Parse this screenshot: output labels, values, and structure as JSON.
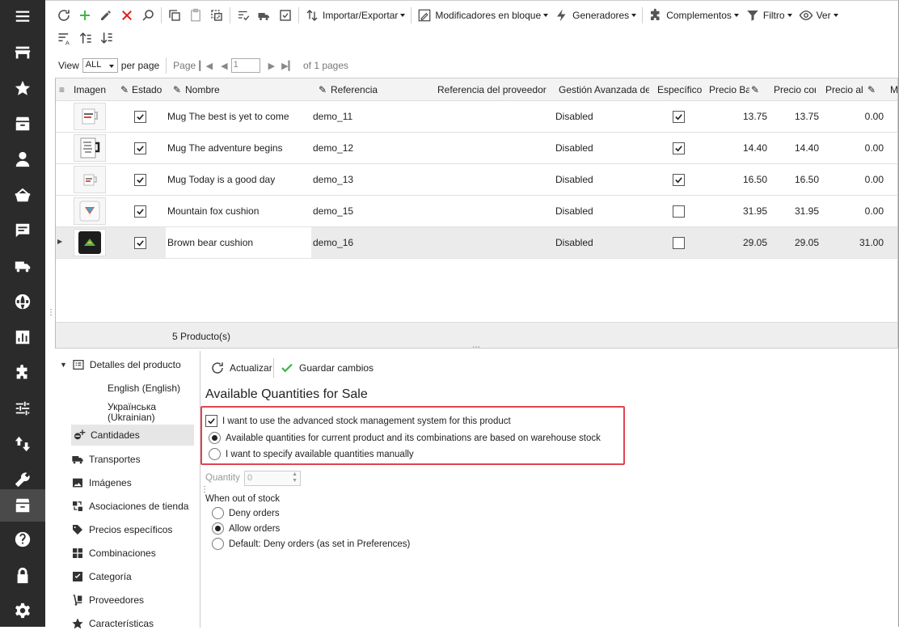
{
  "sidebar": {
    "items": [
      {
        "icon": "menu-icon"
      },
      {
        "icon": "store-icon"
      },
      {
        "icon": "star-icon"
      },
      {
        "icon": "inbox-icon"
      },
      {
        "icon": "user-icon"
      },
      {
        "icon": "basket-icon"
      },
      {
        "icon": "chat-icon"
      },
      {
        "icon": "truck-icon"
      },
      {
        "icon": "globe-icon"
      },
      {
        "icon": "chart-icon"
      },
      {
        "icon": "puzzle-icon"
      },
      {
        "icon": "sliders-icon"
      },
      {
        "icon": "sort-arrows-icon"
      },
      {
        "icon": "wrench-icon"
      },
      {
        "icon": "archive-icon"
      },
      {
        "icon": "help-icon"
      },
      {
        "icon": "lock-icon"
      },
      {
        "icon": "gear-icon"
      }
    ]
  },
  "toolbar": {
    "import_export": "Importar/Exportar",
    "bulk_modifiers": "Modificadores en bloque",
    "generators": "Generadores",
    "addons": "Complementos",
    "filter": "Filtro",
    "view": "Ver"
  },
  "pager": {
    "view_label": "View",
    "per_page_value": "ALL",
    "per_page_label": "per page",
    "page_label": "Page",
    "page_value": "1",
    "of_pages": "of 1 pages"
  },
  "grid": {
    "columns": [
      "Imagen",
      "Estado",
      "Nombre",
      "Referencia",
      "Referencia del proveedor",
      "Gestión Avanzada de",
      "Específico",
      "Precio Bas",
      "Precio cor",
      "Precio al p",
      "M"
    ],
    "rows": [
      {
        "name": "Mug The best is yet to come",
        "ref": "demo_11",
        "advanced": "Disabled",
        "specific": true,
        "base": "13.75",
        "cost": "13.75",
        "retail": "0.00"
      },
      {
        "name": "Mug The adventure begins",
        "ref": "demo_12",
        "advanced": "Disabled",
        "specific": true,
        "base": "14.40",
        "cost": "14.40",
        "retail": "0.00"
      },
      {
        "name": "Mug Today is a good day",
        "ref": "demo_13",
        "advanced": "Disabled",
        "specific": true,
        "base": "16.50",
        "cost": "16.50",
        "retail": "0.00"
      },
      {
        "name": "Mountain fox cushion",
        "ref": "demo_15",
        "advanced": "Disabled",
        "specific": false,
        "base": "31.95",
        "cost": "31.95",
        "retail": "0.00"
      },
      {
        "name": "Brown bear cushion",
        "ref": "demo_16",
        "advanced": "Disabled",
        "specific": false,
        "base": "29.05",
        "cost": "29.05",
        "retail": "31.00"
      }
    ],
    "footer": "5 Producto(s)"
  },
  "tree": {
    "details": "Detalles del producto",
    "english": "English (English)",
    "ukrainian_1": "Українська",
    "ukrainian_2": "(Ukrainian)",
    "quantities": "Cantidades",
    "transport": "Transportes",
    "images": "Imágenes",
    "store_assoc": "Asociaciones de tienda",
    "specific_prices": "Precios específicos",
    "combinations": "Combinaciones",
    "category": "Categoría",
    "suppliers": "Proveedores",
    "features": "Características"
  },
  "panel": {
    "refresh": "Actualizar",
    "save": "Guardar cambios",
    "title": "Available Quantities for Sale",
    "advanced_stock": "I want to use the advanced stock management system for this product",
    "opt_warehouse": "Available quantities for current product and its combinations are based on warehouse stock",
    "opt_manual": "I want to specify available quantities manually",
    "quantity_label": "Quantity",
    "quantity_value": "0",
    "out_of_stock": "When out of stock",
    "deny": "Deny orders",
    "allow": "Allow orders",
    "default": "Default: Deny orders (as set in Preferences)"
  },
  "colors": {
    "sidebar": "#2b2b2b",
    "highlight": "#e04552",
    "check_green": "#3bb54a",
    "delete_red": "#e02020"
  }
}
